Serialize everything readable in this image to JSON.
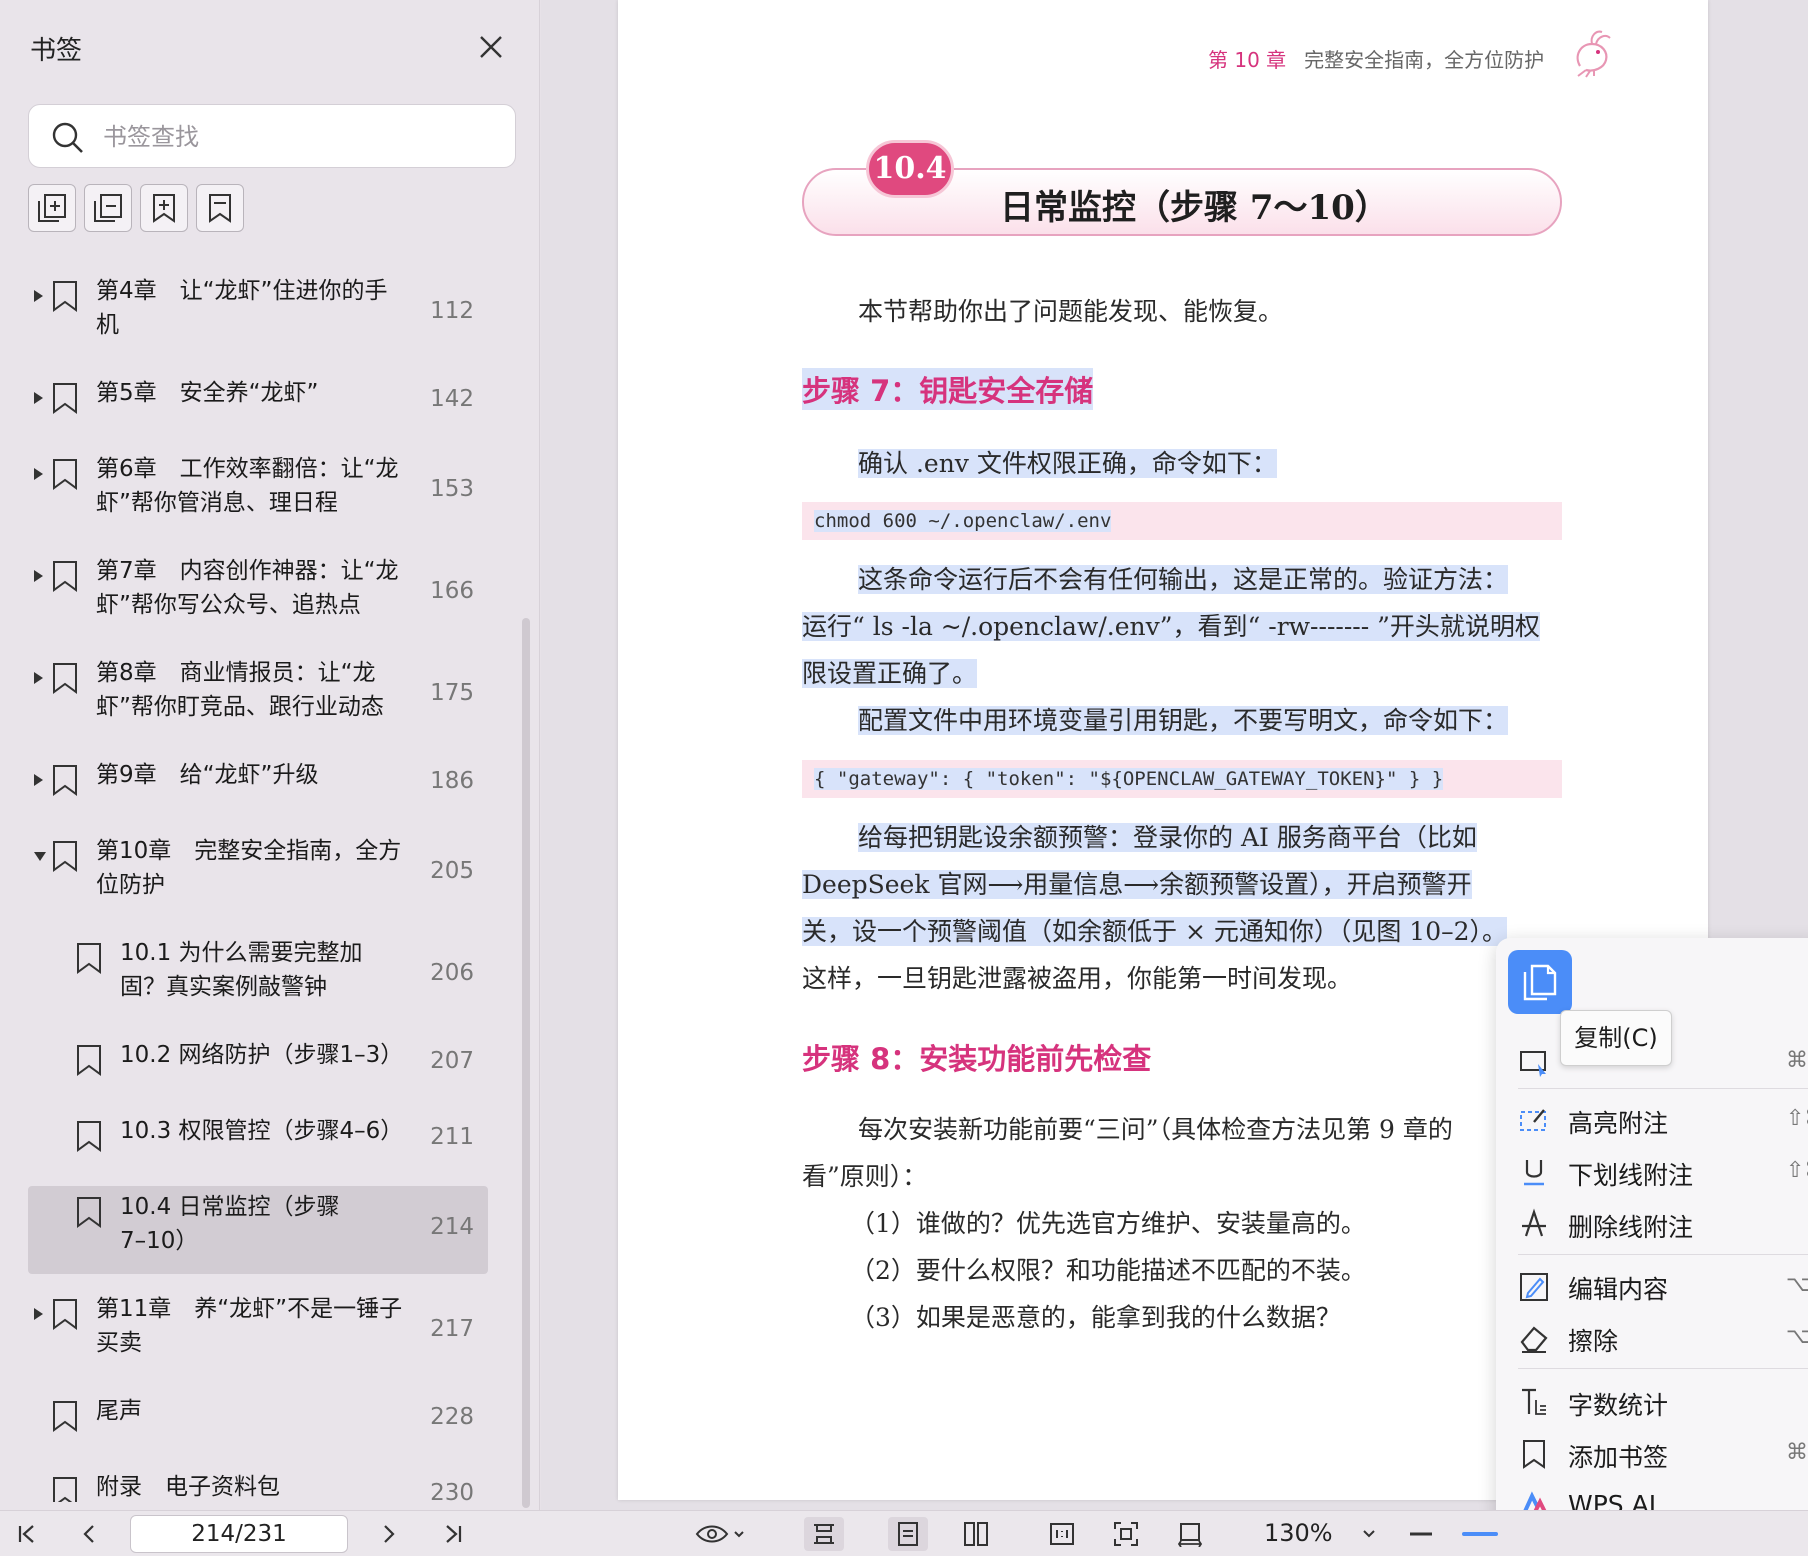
{
  "sidebar": {
    "title": "书签",
    "search_placeholder": "书签查找",
    "bookmarks": [
      {
        "line1": "第4章　让“龙虾”住进你的手",
        "line2": "机",
        "page": "112",
        "expand": "right"
      },
      {
        "line1": "第5章　安全养“龙虾”",
        "line2": "",
        "page": "142",
        "expand": "right"
      },
      {
        "line1": "第6章　工作效率翻倍：让“龙",
        "line2": "虾”帮你管消息、理日程",
        "page": "153",
        "expand": "right"
      },
      {
        "line1": "第7章　内容创作神器：让“龙",
        "line2": "虾”帮你写公众号、追热点",
        "page": "166",
        "expand": "right"
      },
      {
        "line1": "第8章　商业情报员：让“龙",
        "line2": "虾”帮你盯竞品、跟行业动态",
        "page": "175",
        "expand": "right"
      },
      {
        "line1": "第9章　给“龙虾”升级",
        "line2": "",
        "page": "186",
        "expand": "right"
      },
      {
        "line1": "第10章　完整安全指南，全方",
        "line2": "位防护",
        "page": "205",
        "expand": "down"
      },
      {
        "line1": "10.1 为什么需要完整加",
        "line2": "固？真实案例敲警钟",
        "page": "206",
        "expand": "none",
        "child": true
      },
      {
        "line1": "10.2 网络防护（步骤1–3）",
        "line2": "",
        "page": "207",
        "expand": "none",
        "child": true
      },
      {
        "line1": "10.3 权限管控（步骤4–6）",
        "line2": "",
        "page": "211",
        "expand": "none",
        "child": true
      },
      {
        "line1": "10.4 日常监控（步骤",
        "line2": "7–10）",
        "page": "214",
        "expand": "none",
        "child": true,
        "selected": true
      },
      {
        "line1": "第11章　养“龙虾”不是一锤子",
        "line2": "买卖",
        "page": "217",
        "expand": "right"
      },
      {
        "line1": "尾声",
        "line2": "",
        "page": "228",
        "expand": "none"
      },
      {
        "line1": "附录　电子资料包",
        "line2": "",
        "page": "230",
        "expand": "none"
      }
    ]
  },
  "document": {
    "header_chapter": "第 10 章",
    "header_title": "完整安全指南，全方位防护",
    "section_number": "10.4",
    "section_title": "日常监控（步骤 7～10）",
    "intro": "本节帮助你出了问题能发现、能恢复。",
    "step7_heading": "步骤 7：钥匙安全存储",
    "step7_p1": "确认 .env 文件权限正确，命令如下：",
    "code1": "chmod 600 ~/.openclaw/.env",
    "step7_p2_l1": "这条命令运行后不会有任何输出，这是正常的。验证方法：",
    "step7_p2_l2": "运行“ ls -la ~/.openclaw/.env”，看到“ -rw------- ”开头就说明权",
    "step7_p2_l3": "限设置正确了。",
    "step7_p3": "配置文件中用环境变量引用钥匙，不要写明文，命令如下：",
    "code2": "{ \"gateway\": { \"token\": \"${OPENCLAW_GATEWAY_TOKEN}\" } }",
    "step7_p4_l1": "给每把钥匙设余额预警：登录你的 AI 服务商平台（比如",
    "step7_p4_l2": "DeepSeek 官网⟶用量信息⟶余额预警设置），开启预警开",
    "step7_p4_l3": "关，设一个预警阈值（如余额低于 × 元通知你）（见图 10–2）。",
    "step7_p4_l4": "这样，一旦钥匙泄露被盗用，你能第一时间发现。",
    "step8_heading": "步骤 8：安装功能前先检查",
    "step8_p1_l1": "每次安装新功能前要“三问”（具体检查方法见第 9 章的",
    "step8_p1_l2": "看”原则）：",
    "step8_q1": "（1）谁做的？优先选官方维护、安装量高的。",
    "step8_q2": "（2）要什么权限？和功能描述不匹配的不装。",
    "step8_q3": "（3）如果是恶意的，能拿到我的什么数据？"
  },
  "context_menu": {
    "tooltip": "复制(C)",
    "items": {
      "highlight": {
        "label": "高亮附注",
        "key": "⇧⌘"
      },
      "underline": {
        "label": "下划线附注",
        "key": "⇧⌘"
      },
      "strike": {
        "label": "删除线附注",
        "key": ""
      },
      "edit": {
        "label": "编辑内容",
        "key": "⌥"
      },
      "erase": {
        "label": "擦除",
        "key": "⌥"
      },
      "wordcount": {
        "label": "字数统计",
        "key": ""
      },
      "add_bookmark": {
        "label": "添加书签",
        "key": "⌘"
      },
      "wps_ai": {
        "label": "WPS AI",
        "key": ""
      }
    },
    "note_key": "⌘"
  },
  "statusbar": {
    "page_value": "214/231",
    "zoom": "130%"
  },
  "colors": {
    "accent_pink": "#d6337d",
    "highlight_blue": "#d8e3fa",
    "code_bg": "#fbe4ec",
    "menu_accent": "#4b8df8"
  }
}
